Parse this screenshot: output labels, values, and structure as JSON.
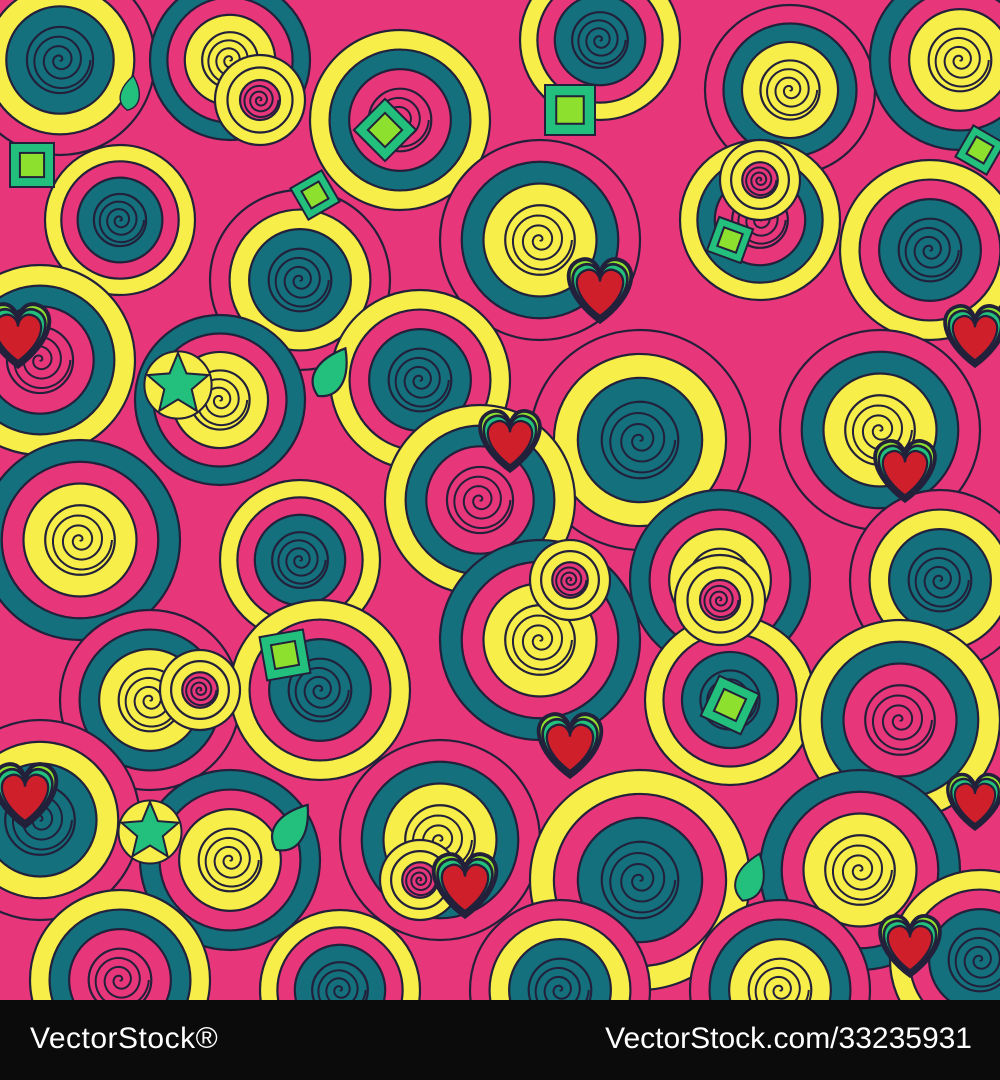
{
  "image": {
    "palette": {
      "pink": "#e8367a",
      "yellow": "#f7ee4a",
      "teal": "#13707c",
      "lime": "#8ee02e",
      "green": "#22c07c",
      "red": "#cf1f2b",
      "outline": "#22203a"
    },
    "motifs": [
      "spiral-icon",
      "heart-icon",
      "star-icon",
      "square-icon",
      "leaf-icon"
    ]
  },
  "watermark": {
    "site": "VectorStock",
    "registered": "®",
    "url": "VectorStock.com/33235931"
  }
}
